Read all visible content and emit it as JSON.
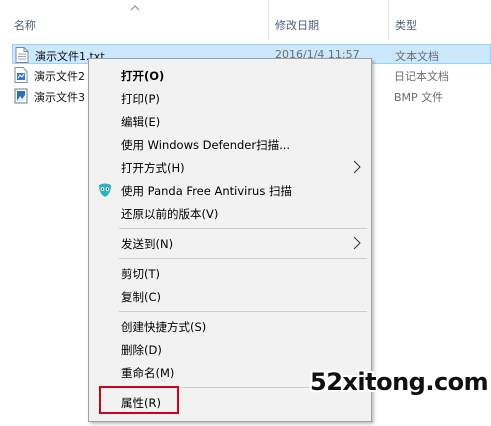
{
  "columns": {
    "name": "名称",
    "date": "修改日期",
    "type": "类型"
  },
  "files": [
    {
      "name": "演示文件1.txt",
      "date": "2016/1/4 11:57",
      "type": "文本文档",
      "icon": "text-file-icon",
      "selected": true
    },
    {
      "name": "演示文件2",
      "date": "",
      "type": "日记本文档",
      "icon": "journal-file-icon",
      "selected": false
    },
    {
      "name": "演示文件3",
      "date": "",
      "type": "BMP 文件",
      "icon": "bmp-file-icon",
      "selected": false
    }
  ],
  "context_menu": {
    "items": [
      {
        "label": "打开(O)",
        "bold": true
      },
      {
        "label": "打印(P)"
      },
      {
        "label": "编辑(E)"
      },
      {
        "label": "使用 Windows Defender扫描..."
      },
      {
        "label": "打开方式(H)",
        "submenu": true
      },
      {
        "label": "使用 Panda Free Antivirus 扫描",
        "icon": "panda-antivirus-icon"
      },
      {
        "label": "还原以前的版本(V)"
      },
      {
        "label": "发送到(N)",
        "submenu": true
      },
      {
        "label": "剪切(T)"
      },
      {
        "label": "复制(C)"
      },
      {
        "label": "创建快捷方式(S)"
      },
      {
        "label": "删除(D)"
      },
      {
        "label": "重命名(M)"
      },
      {
        "label": "属性(R)",
        "highlighted": true
      }
    ]
  },
  "watermark": "52xitong.com",
  "colors": {
    "selection_bg": "#cce8ff",
    "selection_border": "#99d1ff",
    "menu_bg": "#f2f2f2",
    "highlight_border": "#d0021b",
    "header_text": "#4c607a"
  }
}
